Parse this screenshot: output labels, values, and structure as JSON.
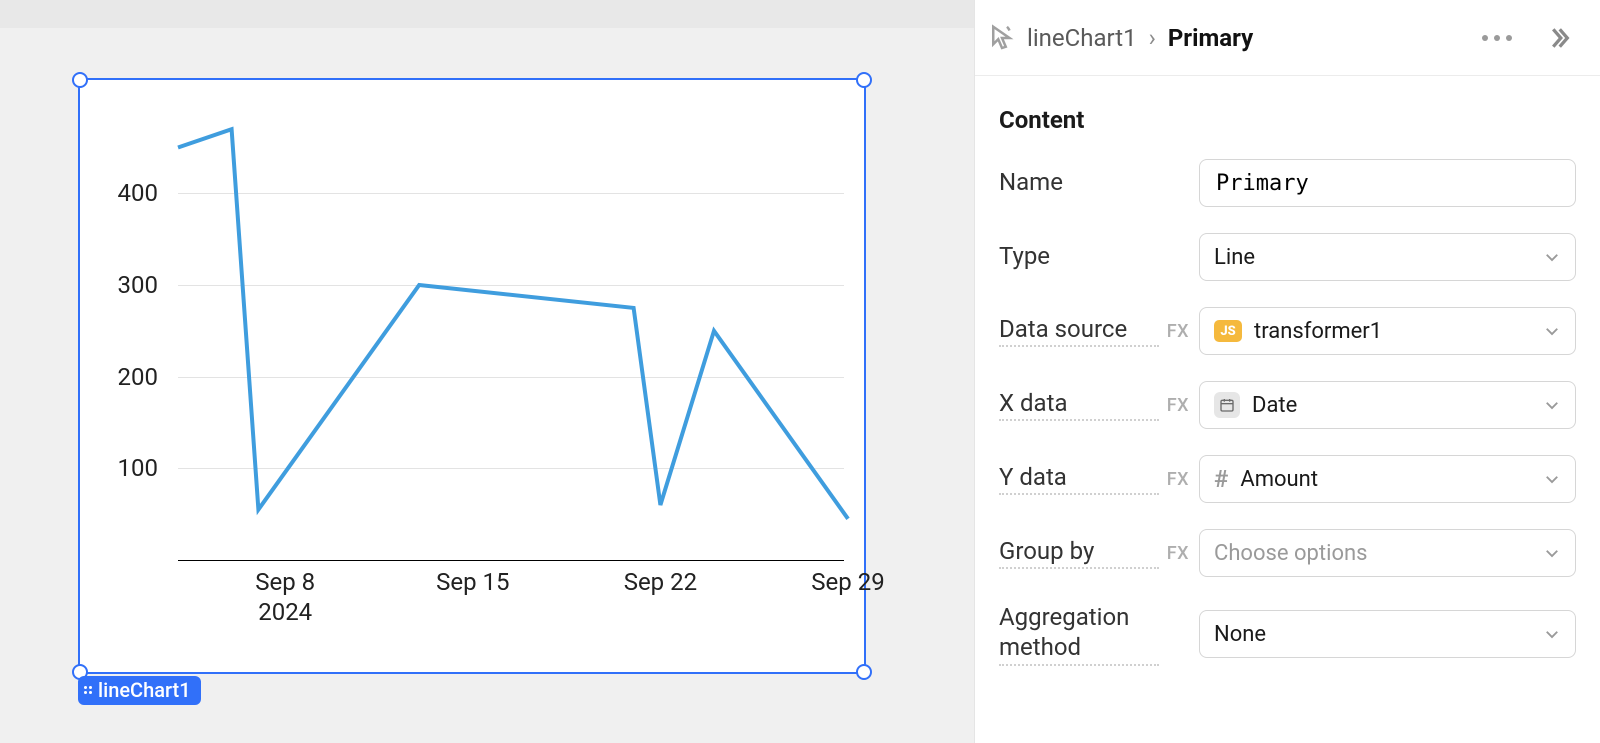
{
  "canvas": {
    "component_name": "lineChart1"
  },
  "chart_data": {
    "type": "line",
    "x": [
      "2024-09-04",
      "2024-09-06",
      "2024-09-07",
      "2024-09-13",
      "2024-09-21",
      "2024-09-22",
      "2024-09-24",
      "2024-09-29"
    ],
    "values": [
      450,
      470,
      55,
      300,
      275,
      60,
      250,
      45
    ],
    "y_ticks": [
      100,
      200,
      300,
      400
    ],
    "x_ticks": [
      "Sep 8",
      "Sep 15",
      "Sep 22",
      "Sep 29"
    ],
    "x_year": "2024",
    "y_range": [
      0,
      480
    ],
    "line_color": "#3f9dde",
    "selection_color": "#3170f9"
  },
  "inspector": {
    "breadcrumb": {
      "component": "lineChart1",
      "series": "Primary"
    },
    "section_content": "Content",
    "fields": {
      "name": {
        "label": "Name",
        "value": "Primary"
      },
      "type": {
        "label": "Type",
        "value": "Line"
      },
      "data_source": {
        "label": "Data source",
        "fx": "FX",
        "value": "transformer1"
      },
      "x_data": {
        "label": "X data",
        "fx": "FX",
        "value": "Date"
      },
      "y_data": {
        "label": "Y data",
        "fx": "FX",
        "value": "Amount"
      },
      "group_by": {
        "label": "Group by",
        "fx": "FX",
        "placeholder": "Choose options"
      },
      "aggregation": {
        "label": "Aggregation method",
        "value": "None"
      }
    }
  }
}
